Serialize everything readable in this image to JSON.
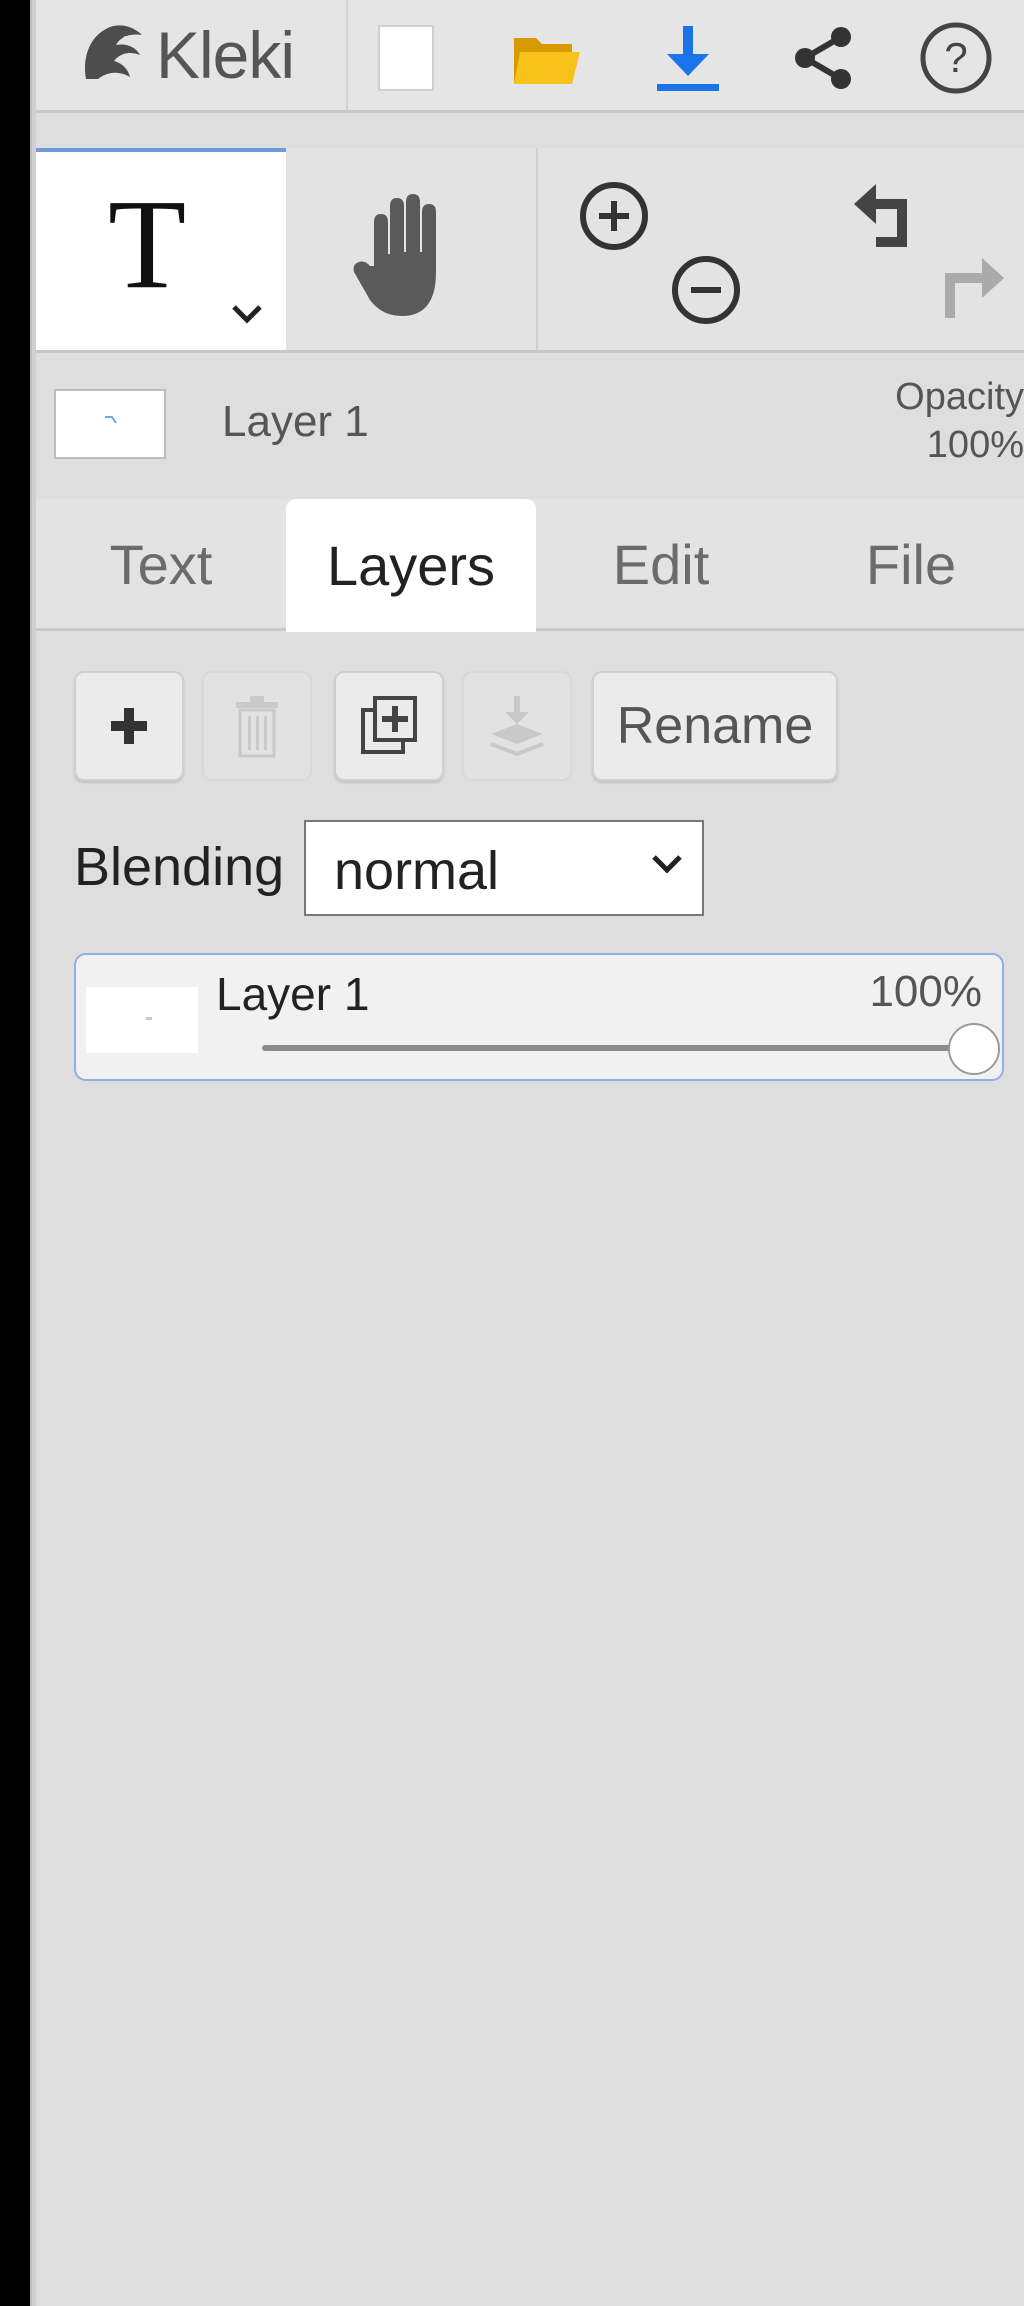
{
  "app": {
    "name": "Kleki"
  },
  "topbar": {
    "icons": [
      "kleki-logo-icon",
      "new-image-icon",
      "open-folder-icon",
      "download-icon",
      "share-icon",
      "help-icon"
    ]
  },
  "tools": {
    "active": "text",
    "icons": [
      "text-tool-icon",
      "hand-tool-icon",
      "zoom-in-icon",
      "zoom-out-icon",
      "undo-icon",
      "redo-icon"
    ]
  },
  "layer_info": {
    "name": "Layer 1",
    "opacity_label": "Opacity",
    "opacity_value": "100%"
  },
  "tabs": [
    {
      "label": "Text",
      "active": false
    },
    {
      "label": "Layers",
      "active": true
    },
    {
      "label": "Edit",
      "active": false
    },
    {
      "label": "File",
      "active": false
    }
  ],
  "layer_buttons": {
    "add": {
      "icon": "plus-icon",
      "enabled": true
    },
    "delete": {
      "icon": "trash-icon",
      "enabled": false
    },
    "duplicate": {
      "icon": "duplicate-icon",
      "enabled": true
    },
    "merge": {
      "icon": "merge-down-icon",
      "enabled": false
    },
    "rename_label": "Rename"
  },
  "blending": {
    "label": "Blending",
    "value": "normal"
  },
  "layers": [
    {
      "name": "Layer 1",
      "opacity": "100%",
      "opacity_fraction": 1.0,
      "selected": true
    }
  ],
  "colors": {
    "accent_blue": "#1a73e8",
    "folder_yellow": "#f5b800",
    "selection_border": "#8fb0e0"
  }
}
